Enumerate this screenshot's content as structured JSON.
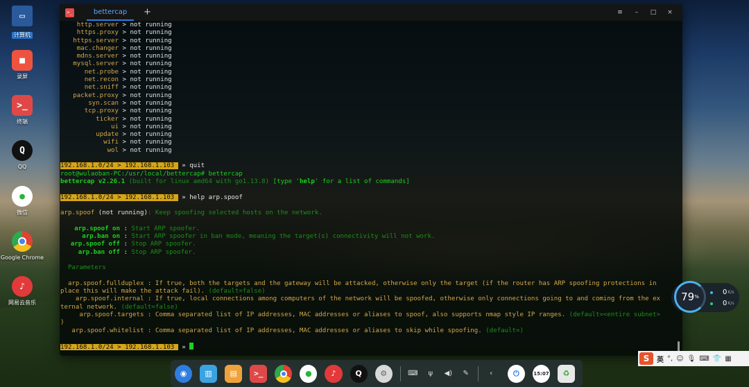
{
  "desktop": {
    "icons": [
      {
        "label": "计算机",
        "icon": "computer-icon",
        "selected": true
      },
      {
        "label": "录屏",
        "icon": "screen-recorder-icon"
      },
      {
        "label": "终端",
        "icon": "terminal-icon"
      },
      {
        "label": "QQ",
        "icon": "qq-penguin-icon"
      },
      {
        "label": "微信",
        "icon": "wechat-icon"
      },
      {
        "label": "Google Chrome",
        "icon": "chrome-icon"
      },
      {
        "label": "网易云音乐",
        "icon": "netease-music-icon"
      }
    ]
  },
  "terminal": {
    "tab_title": "bettercap",
    "add_tab": "+",
    "window_buttons": {
      "menu": "≡",
      "minimize": "–",
      "maximize": "□",
      "close": "×"
    },
    "modules": [
      {
        "name": "http.server",
        "status": "not running"
      },
      {
        "name": "https.proxy",
        "status": "not running"
      },
      {
        "name": "https.server",
        "status": "not running"
      },
      {
        "name": "mac.changer",
        "status": "not running"
      },
      {
        "name": "mdns.server",
        "status": "not running"
      },
      {
        "name": "mysql.server",
        "status": "not running"
      },
      {
        "name": "net.probe",
        "status": "not running"
      },
      {
        "name": "net.recon",
        "status": "not running"
      },
      {
        "name": "net.sniff",
        "status": "not running"
      },
      {
        "name": "packet.proxy",
        "status": "not running"
      },
      {
        "name": "syn.scan",
        "status": "not running"
      },
      {
        "name": "tcp.proxy",
        "status": "not running"
      },
      {
        "name": "ticker",
        "status": "not running"
      },
      {
        "name": "ui",
        "status": "not running"
      },
      {
        "name": "update",
        "status": "not running"
      },
      {
        "name": "wifi",
        "status": "not running"
      },
      {
        "name": "wol",
        "status": "not running"
      }
    ],
    "prompt_ip": "192.168.1.0/24",
    "prompt_host": "192.168.1.103",
    "cmd_quit": "» quit",
    "shell_line": "root@wulaoban-PC:/usr/local/bettercap# bettercap",
    "banner_name": "bettercap v2.26.1",
    "banner_built": "(built for linux amd64 with go1.13.8)",
    "banner_help_pre": "[type '",
    "banner_help_word": "help",
    "banner_help_post": "' for a list of commands]",
    "cmd_help": "» help arp.spoof",
    "desc_module": "arp.spoof",
    "desc_status": "(not running)",
    "desc_text": ": Keep spoofing selected hosts on the network.",
    "commands": [
      {
        "cmd": "arp.spoof on",
        "desc": "Start ARP spoofer."
      },
      {
        "cmd": "arp.ban on",
        "desc": "Start ARP spoofer in ban mode, meaning the target(s) connectivity will not work."
      },
      {
        "cmd": "arp.spoof off",
        "desc": "Stop ARP spoofer."
      },
      {
        "cmd": "arp.ban off",
        "desc": "Stop ARP spoofer."
      }
    ],
    "params_header": "Parameters",
    "param1_a": "  arp.spoof.fullduplex : If true, both the targets and the gateway will be attacked, otherwise only the target (if the router has ARP spoofing protections in",
    "param1_b": "place this will make the attack fail).",
    "param1_def": "(default=false)",
    "param2_a": "    arp.spoof.internal : If true, local connections among computers of the network will be spoofed, otherwise only connections going to and coming from the ex",
    "param2_b": "ternal network.",
    "param2_def": "(default=false)",
    "param3_a": "     arp.spoof.targets : Comma separated list of IP addresses, MAC addresses or aliases to spoof, also supports nmap style IP ranges.",
    "param3_def": "(default=<entire subnet>",
    "param3_b": ")",
    "param4_a": "   arp.spoof.whitelist : Comma separated list of IP addresses, MAC addresses or aliases to skip while spoofing.",
    "param4_def": "(default=)",
    "final_arrow": "»"
  },
  "net_widget": {
    "percent": "79",
    "percent_unit": "%",
    "up": "0",
    "up_unit": "K/s",
    "down": "0",
    "down_unit": "K/s"
  },
  "ime": {
    "logo": "S",
    "lang": "英"
  },
  "dock": {
    "apps": [
      {
        "icon": "launcher-icon",
        "color": "#2f7de0"
      },
      {
        "icon": "file-manager-icon",
        "color": "#3aa3e0"
      },
      {
        "icon": "app-store-icon",
        "color": "#f0a23a"
      },
      {
        "icon": "terminal-icon",
        "color": "#e04848"
      },
      {
        "icon": "chrome-icon",
        "color": "#ffffff"
      },
      {
        "icon": "wechat-icon",
        "color": "#ffffff"
      },
      {
        "icon": "netease-music-icon",
        "color": "#e23a3a"
      },
      {
        "icon": "qq-penguin-icon",
        "color": "#000000"
      },
      {
        "icon": "settings-gear-icon",
        "color": "#d8d8d8"
      }
    ],
    "clock": "15:07"
  }
}
